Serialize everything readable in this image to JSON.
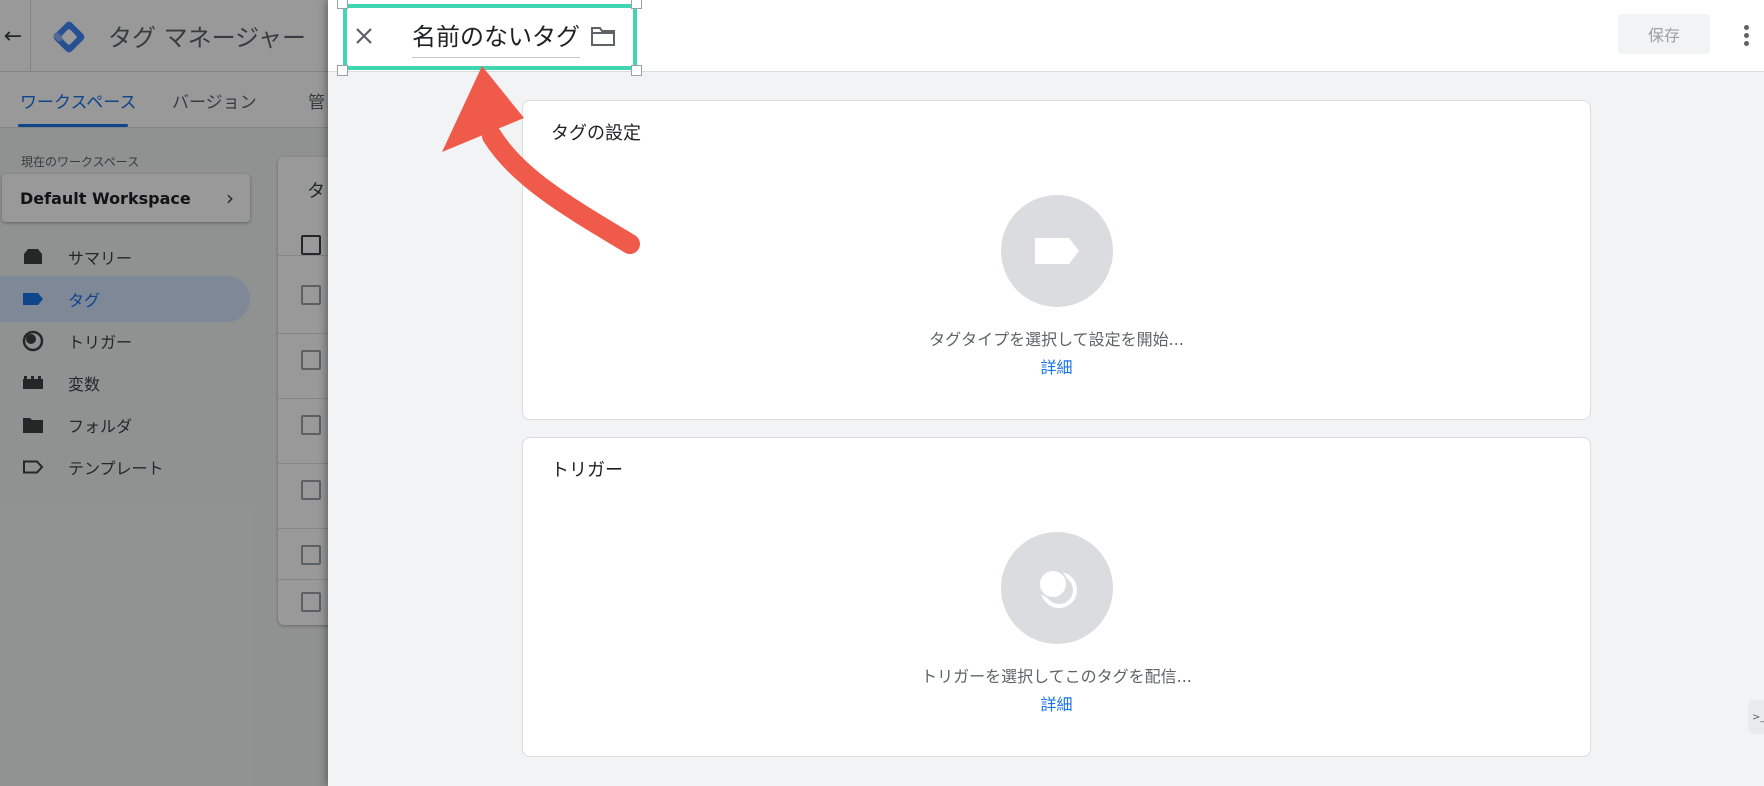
{
  "app": {
    "title": "タグ マネージャー",
    "tabs": [
      {
        "label": "ワークスペース",
        "active": true
      },
      {
        "label": "バージョン",
        "active": false
      },
      {
        "label": "管",
        "active": false
      }
    ],
    "workspace": {
      "caption": "現在のワークスペース",
      "name": "Default Workspace"
    },
    "nav": [
      {
        "label": "サマリー",
        "icon": "summary-icon",
        "active": false
      },
      {
        "label": "タグ",
        "icon": "tag-icon",
        "active": true
      },
      {
        "label": "トリガー",
        "icon": "trigger-icon",
        "active": false
      },
      {
        "label": "変数",
        "icon": "variable-icon",
        "active": false
      },
      {
        "label": "フォルダ",
        "icon": "folder-icon",
        "active": false
      },
      {
        "label": "テンプレート",
        "icon": "template-icon",
        "active": false
      }
    ],
    "list_header": "タ"
  },
  "panel": {
    "tag_name": "名前のないタグ",
    "save_label": "保存",
    "tag_config": {
      "title": "タグの設定",
      "hint": "タグタイプを選択して設定を開始...",
      "link": "詳細"
    },
    "trigger": {
      "title": "トリガー",
      "hint": "トリガーを選択してこのタグを配信...",
      "link": "詳細"
    },
    "side_tab_label": ">_"
  },
  "colors": {
    "accent": "#1a73e8",
    "highlight": "#3fd6b1",
    "arrow": "#f05a4a",
    "circle": "#dadce0"
  }
}
